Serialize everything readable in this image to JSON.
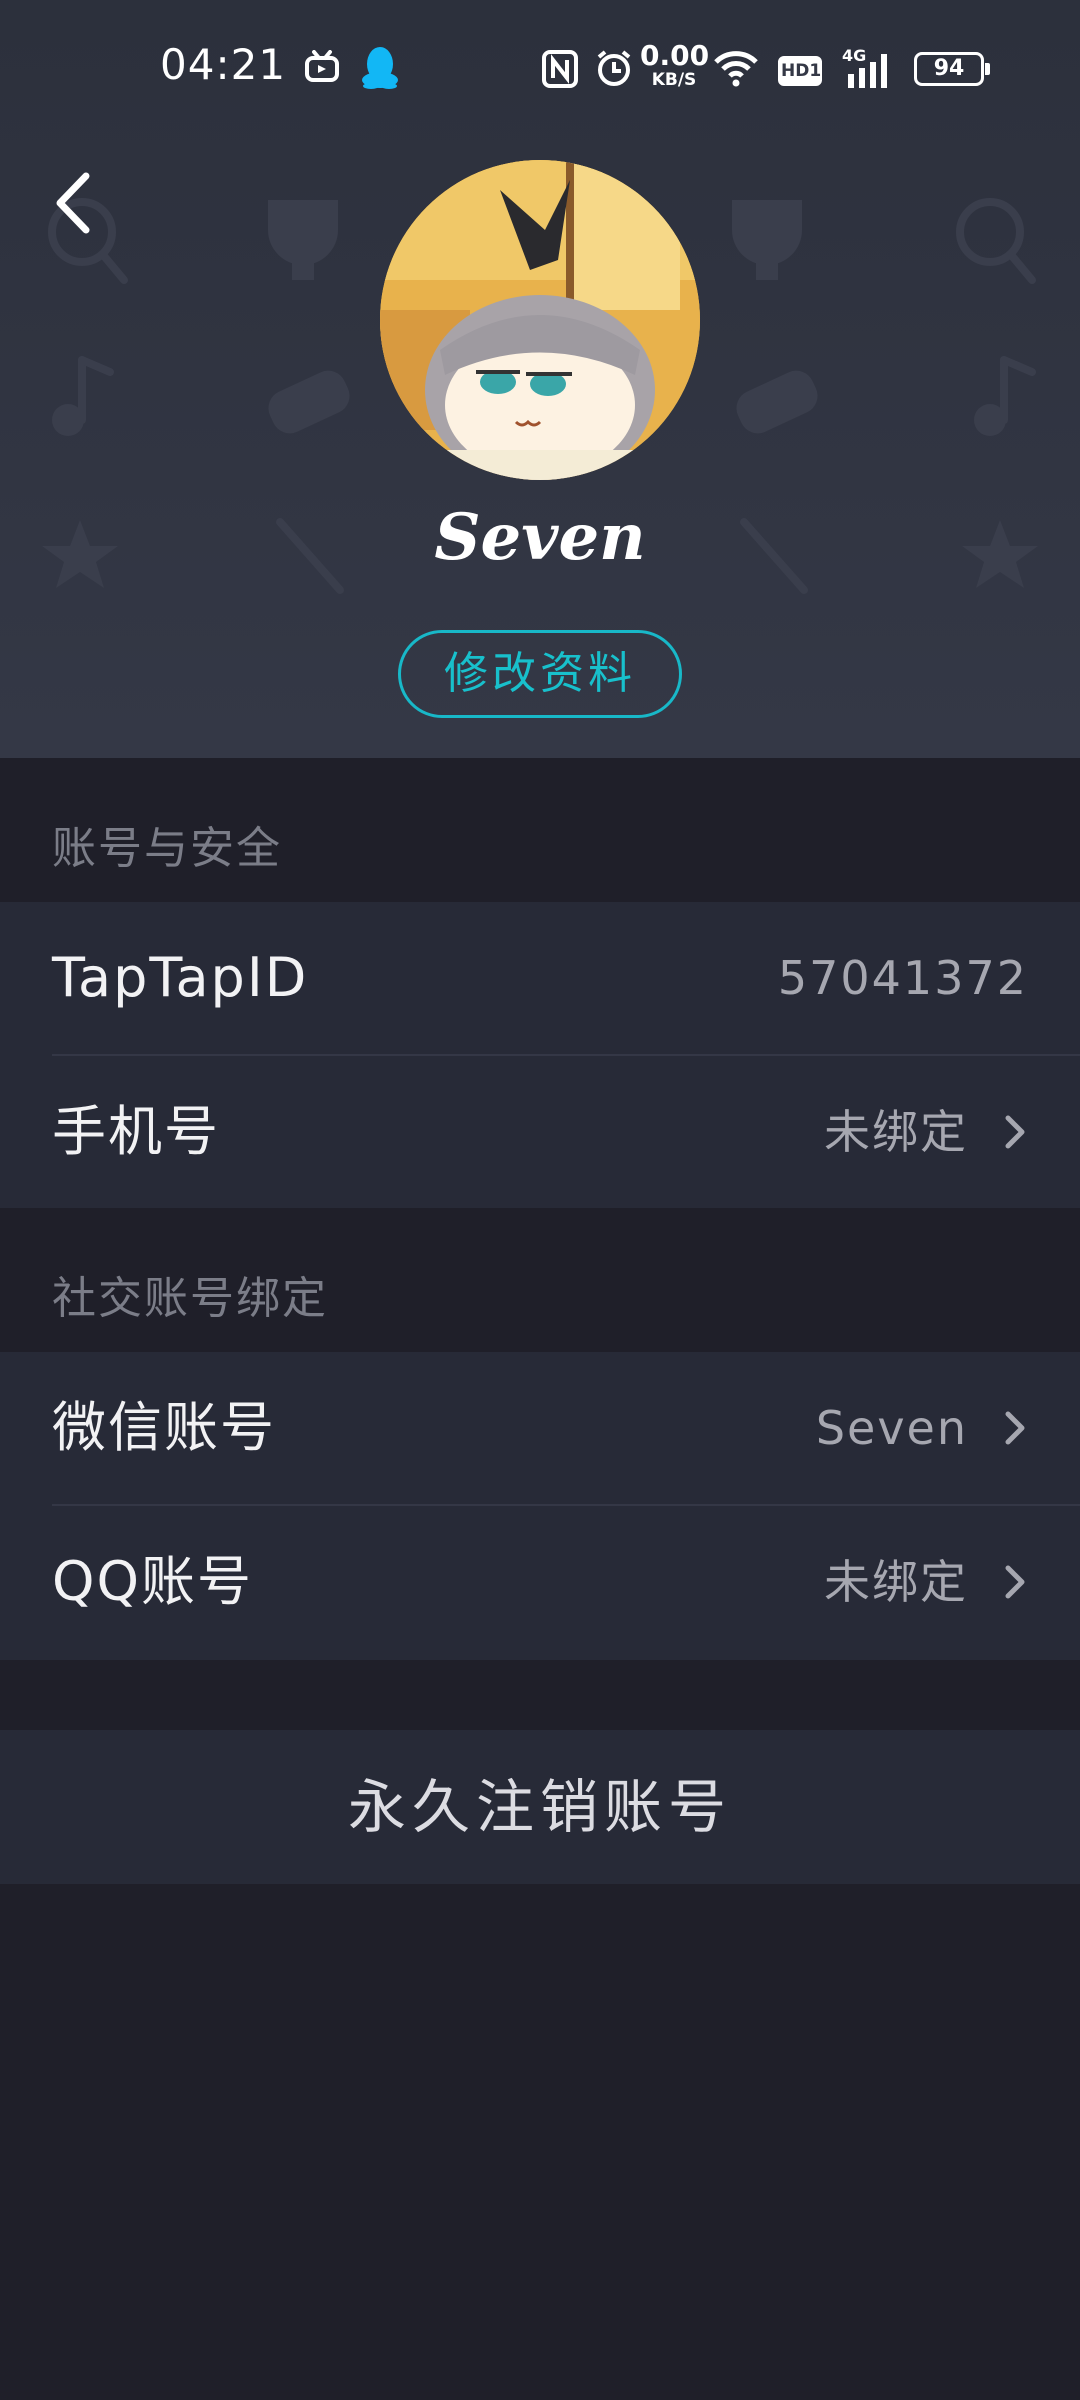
{
  "status_bar": {
    "time": "04:21",
    "net_speed_value": "0.00",
    "net_speed_unit": "KB/S",
    "hd_label": "HD1",
    "network_label": "4G",
    "battery": "94"
  },
  "profile": {
    "username": "Seven",
    "edit_button": "修改资料"
  },
  "sections": {
    "account_security": {
      "title": "账号与安全",
      "rows": [
        {
          "label": "TapTapID",
          "value": "57041372"
        },
        {
          "label": "手机号",
          "value": "未绑定"
        }
      ]
    },
    "social_binding": {
      "title": "社交账号绑定",
      "rows": [
        {
          "label": "微信账号",
          "value": "Seven"
        },
        {
          "label": "QQ账号",
          "value": "未绑定"
        }
      ]
    }
  },
  "delete_account": "永久注销账号",
  "colors": {
    "accent": "#18c0cc",
    "background": "#1f1f29",
    "card": "#272a37",
    "header": "#343846"
  }
}
